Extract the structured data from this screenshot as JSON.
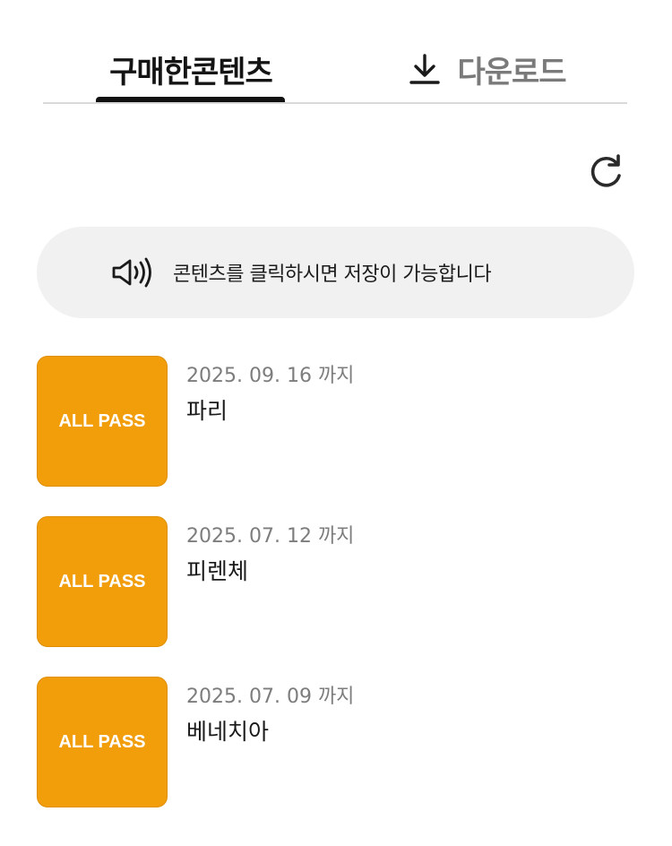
{
  "tabs": {
    "purchased_label": "구매한콘텐츠",
    "download_label": "다운로드",
    "active": "purchased"
  },
  "notice": {
    "icon": "speaker-icon",
    "text": "콘텐츠를 클릭하시면 저장이 가능합니다"
  },
  "refresh": {
    "icon": "refresh-icon"
  },
  "items": [
    {
      "thumb_label": "ALL PASS",
      "expiry": "2025. 09. 16 까지",
      "title": "파리"
    },
    {
      "thumb_label": "ALL PASS",
      "expiry": "2025. 07. 12 까지",
      "title": "피렌체"
    },
    {
      "thumb_label": "ALL PASS",
      "expiry": "2025. 07. 09 까지",
      "title": "베네치아"
    }
  ],
  "colors": {
    "accent": "#f29d0a",
    "active_tab": "#141414",
    "inactive_tab": "#7a7a7a",
    "notice_bg": "#f1f1f1",
    "expiry_text": "#7d7d7d"
  }
}
